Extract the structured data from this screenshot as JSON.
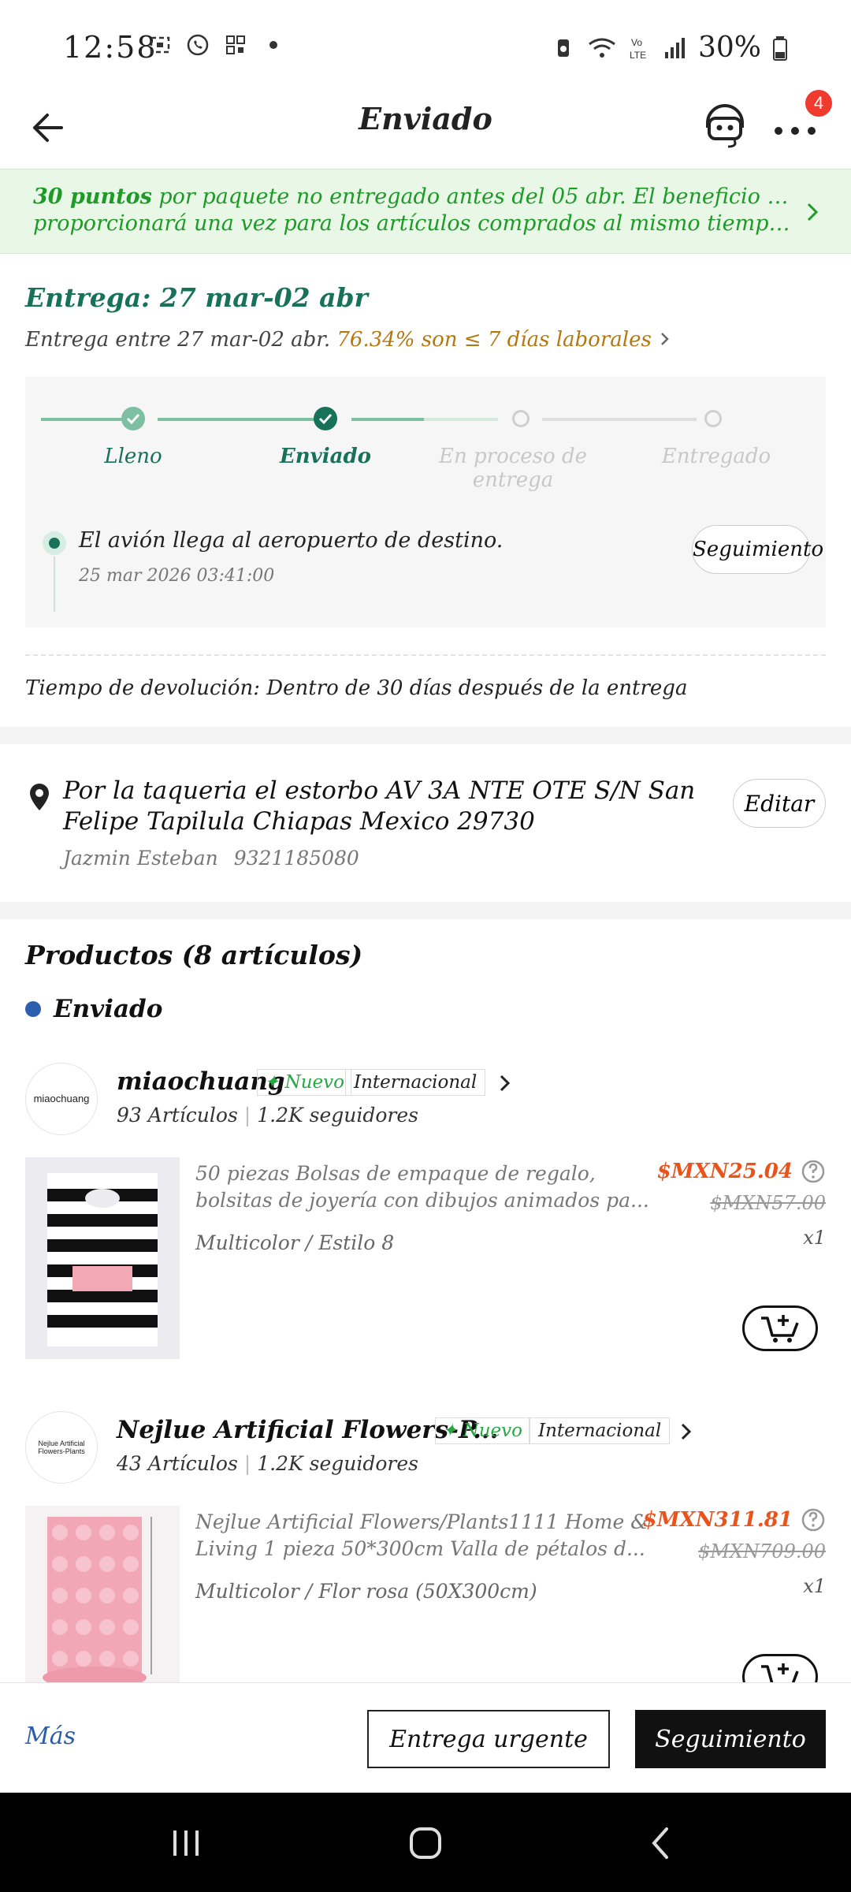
{
  "status_bar": {
    "time": "12:58",
    "battery": "30%"
  },
  "header": {
    "title": "Enviado",
    "notification_count": "4"
  },
  "promo": {
    "points": "30 puntos",
    "text_line1": " por paquete no entregado antes del 05 abr. El beneficio solo se",
    "text_line2": "proporcionará una vez para los artículos comprados al mismo tiempo y se a..."
  },
  "delivery": {
    "title": "Entrega: 27 mar-02 abr",
    "range_text": "Entrega entre 27 mar-02 abr.",
    "stat_text": "76.34% son ≤ 7 días laborales",
    "steps": [
      {
        "label": "Lleno",
        "state": "done"
      },
      {
        "label": "Enviado",
        "state": "current"
      },
      {
        "label": "En proceso de entrega",
        "state": "todo"
      },
      {
        "label": "Entregado",
        "state": "todo"
      }
    ],
    "latest_event": "El avión llega al aeropuerto de destino.",
    "latest_event_time": "25 mar 2026 03:41:00",
    "tracking_button": "Seguimiento",
    "return_time": "Tiempo de devolución: Dentro de 30 días después de la entrega"
  },
  "address": {
    "line": "Por la taqueria el estorbo AV 3A NTE OTE S/N San Felipe Tapilula Chiapas Mexico 29730",
    "recipient": "Jazmin Esteban",
    "phone": "9321185080",
    "edit_button": "Editar"
  },
  "products": {
    "title": "Productos (8 artículos)",
    "group_status": "Enviado",
    "stores": [
      {
        "logo_text": "miaochuang",
        "name": "miaochuang",
        "tag_new": "Nuevo",
        "tag_intl": "Internacional",
        "items_count": "93 Artículos",
        "followers": "1.2K seguidores",
        "product": {
          "name_line1": "50 piezas Bolsas de empaque de regalo,",
          "name_line2": "bolsitas de joyería con dibujos animados pa...",
          "variant": "Multicolor / Estilo 8",
          "price": "$MXN25.04",
          "old_price": "$MXN57.00",
          "qty": "x1"
        }
      },
      {
        "logo_text": "Nejlue Artificial Flowers-Plants",
        "name": "Nejlue Artificial Flowers-P...",
        "tag_new": "Nuevo",
        "tag_intl": "Internacional",
        "items_count": "43 Artículos",
        "followers": "1.2K seguidores",
        "product": {
          "name_line1": "Nejlue Artificial Flowers/Plants1111 Home &",
          "name_line2": "Living 1 pieza 50*300cm Valla de pétalos d...",
          "variant": "Multicolor / Flor rosa (50X300cm)",
          "price": "$MXN311.81",
          "old_price": "$MXN709.00",
          "qty": "x1"
        }
      }
    ]
  },
  "bottom_bar": {
    "more": "Más",
    "urgent_button": "Entrega urgente",
    "tracking_button": "Seguimiento"
  },
  "colors": {
    "delivery_green": "#18725a",
    "promo_green": "#1e9a28",
    "price_orange": "#e9541c",
    "badge_red": "#f03a2e"
  }
}
